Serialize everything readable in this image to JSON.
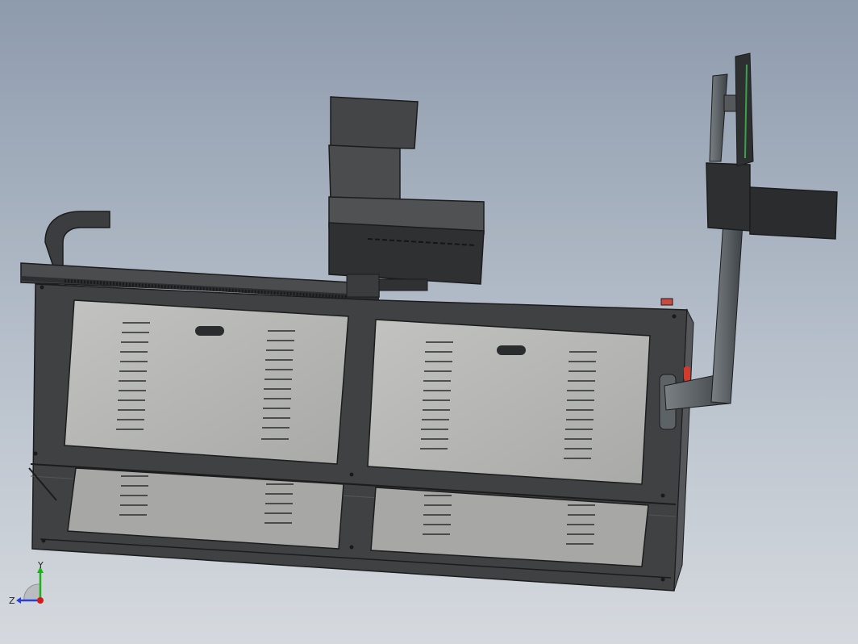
{
  "viewport": {
    "background_top": "#8e9bad",
    "background_bottom": "#d5d9de"
  },
  "model": {
    "frame_color": "#3f4143",
    "panel_color": "#b5b6b4",
    "dark_body_color": "#2e3032",
    "pole_color": "#5e6468",
    "knob_color": "#d23a2e",
    "screen_edge_color": "#3aa24a"
  },
  "triad": {
    "x_label": "",
    "y_label": "Y",
    "z_label": "Z",
    "y_color": "#1bb21b",
    "z_color": "#2a3fd8",
    "x_color": "#d21c1c"
  }
}
